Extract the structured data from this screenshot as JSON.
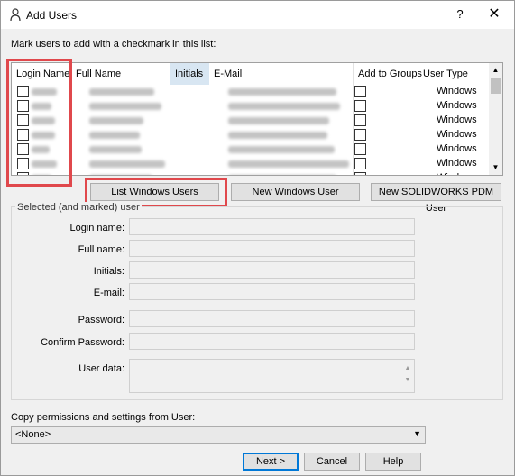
{
  "window": {
    "title": "Add Users",
    "help_glyph": "?",
    "close_glyph": "✕"
  },
  "instruction": "Mark users to add with a checkmark in this list:",
  "user_list": {
    "columns": [
      "Login Name",
      "Full Name",
      "Initials",
      "E-Mail",
      "Add to Groups",
      "User Type"
    ],
    "rows": [
      {
        "user_type": "Windows"
      },
      {
        "user_type": "Windows"
      },
      {
        "user_type": "Windows"
      },
      {
        "user_type": "Windows"
      },
      {
        "user_type": "Windows"
      },
      {
        "user_type": "Windows"
      },
      {
        "user_type": "Windows"
      }
    ]
  },
  "buttons": {
    "list_windows_users": "List Windows Users",
    "new_windows_user": "New Windows User",
    "new_pdm_user": "New SOLIDWORKS PDM User",
    "next": "Next >",
    "cancel": "Cancel",
    "help": "Help"
  },
  "selected_user": {
    "group_title": "Selected (and marked) user",
    "login_name_label": "Login name:",
    "full_name_label": "Full name:",
    "initials_label": "Initials:",
    "email_label": "E-mail:",
    "password_label": "Password:",
    "confirm_password_label": "Confirm Password:",
    "user_data_label": "User data:"
  },
  "copy_permissions": {
    "label": "Copy permissions and settings from User:",
    "selected": "<None>"
  },
  "colors": {
    "highlight": "#e0484c",
    "selected_header": "#d8e6f2",
    "default_button_border": "#0078d7"
  }
}
